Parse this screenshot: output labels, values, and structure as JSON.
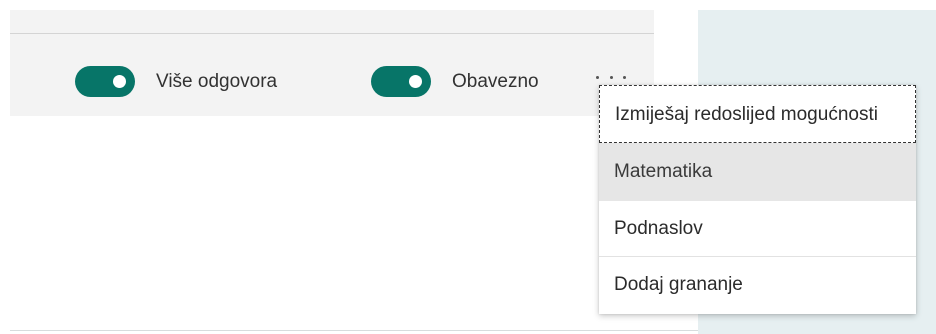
{
  "question_footer": {
    "multiple_answers_label": "Više odgovora",
    "multiple_answers_on": true,
    "required_label": "Obavezno",
    "required_on": true,
    "more_options_icon": "ellipsis-icon"
  },
  "more_menu": {
    "items": [
      {
        "label": "Izmiješaj redoslijed mogućnosti"
      },
      {
        "label": "Matematika"
      },
      {
        "label": "Podnaslov"
      },
      {
        "label": "Dodaj grananje"
      }
    ]
  },
  "colors": {
    "toggle_on": "#077568",
    "side_panel": "#e6eff1",
    "footer_bg": "#f3f3f3",
    "menu_hover": "#e6e6e6"
  }
}
